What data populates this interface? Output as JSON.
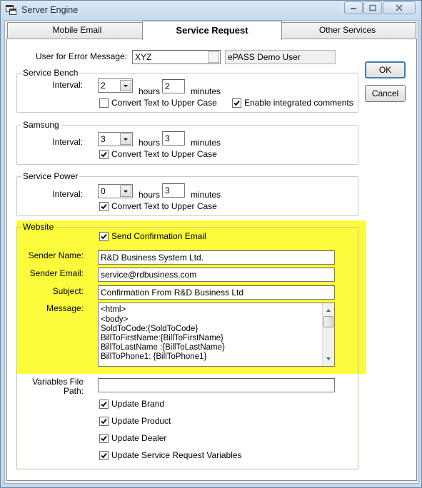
{
  "window": {
    "title": "Server Engine"
  },
  "tabs": [
    {
      "label": "Mobile Email"
    },
    {
      "label": "Service Request"
    },
    {
      "label": "Other Services"
    }
  ],
  "error_user": {
    "label": "User for Error Message:",
    "value": "XYZ",
    "display_name": "ePASS Demo User"
  },
  "buttons": {
    "ok": "OK",
    "cancel": "Cancel"
  },
  "service_bench": {
    "title": "Service Bench",
    "interval_label": "Interval:",
    "hours_value": "2",
    "hours_label": "hours",
    "minutes_value": "2",
    "minutes_label": "minutes",
    "upper_case_label": "Convert Text to Upper Case",
    "upper_case_checked": false,
    "integrated_label": "Enable integrated comments",
    "integrated_checked": true
  },
  "samsung": {
    "title": "Samsung",
    "interval_label": "Interval:",
    "hours_value": "3",
    "hours_label": "hours",
    "minutes_value": "3",
    "minutes_label": "minutes",
    "upper_case_label": "Convert Text to Upper Case",
    "upper_case_checked": true
  },
  "service_power": {
    "title": "Service Power",
    "interval_label": "Interval:",
    "hours_value": "0",
    "hours_label": "hours",
    "minutes_value": "3",
    "minutes_label": "minutes",
    "upper_case_label": "Convert Text to Upper Case",
    "upper_case_checked": true
  },
  "website": {
    "title": "Website",
    "send_confirmation_label": "Send Confirmation Email",
    "send_confirmation_checked": true,
    "sender_name_label": "Sender Name:",
    "sender_name_value": "R&D Business System Ltd.",
    "sender_email_label": "Sender Email:",
    "sender_email_value": "service@rdbusiness.com",
    "subject_label": "Subject:",
    "subject_value": "Confirmation From R&D Business Ltd",
    "message_label": "Message:",
    "message_lines": [
      "<html>",
      "<body>",
      "SoldToCode:{SoldToCode}",
      "BillToFirstName:{BillToFirstName}",
      "BillToLastName :{BillToLastName}",
      "BillToPhone1: {BillToPhone1}"
    ],
    "highlight_color": "#fbfb3c"
  },
  "variables": {
    "path_label_line1": "Variables File",
    "path_label_line2": "Path:",
    "path_value": "",
    "options": [
      {
        "label": "Update Brand",
        "checked": true
      },
      {
        "label": "Update Product",
        "checked": true
      },
      {
        "label": "Update Dealer",
        "checked": true
      },
      {
        "label": "Update Service Request Variables",
        "checked": true
      }
    ]
  }
}
